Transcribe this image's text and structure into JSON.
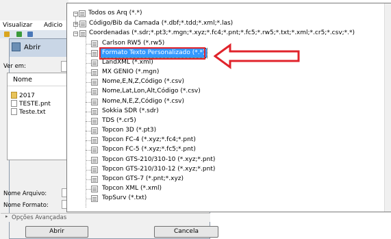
{
  "background_app": {
    "menu": [
      "Visualizar",
      "Adicio"
    ]
  },
  "dialog": {
    "title": "Abrir",
    "look_in_label": "Ver em:",
    "column_name": "Nome",
    "files": [
      {
        "name": "2017",
        "type": "folder"
      },
      {
        "name": "TESTE.pnt",
        "type": "file"
      },
      {
        "name": "Teste.txt",
        "type": "file"
      }
    ],
    "filename_label": "Nome Arquivo:",
    "format_label": "Nome Formato:",
    "advanced_options": "Opções Avançadas",
    "open_button": "Abrir",
    "cancel_button": "Cancela"
  },
  "dropdown": {
    "root": "Todos os Arq (*.*)",
    "groups": [
      {
        "label": "Código/Bib da Camada (*.dbf;*.tdd;*.xml;*.las)",
        "expander": "+"
      },
      {
        "label": "Coordenadas (*.sdr;*.pt3;*.mgn;*.xyz;*.fc4;*.pnt;*.fc5;*.rw5;*.txt;*.xml;*.cr5;*.csv;*.*)",
        "expander": "−"
      }
    ],
    "children": [
      "Carlson RW5 (*.rw5)",
      "Formato Texto Personalizado (*.*)",
      "LandXML (*.xml)",
      "MX GENIO (*.mgn)",
      "Nome,E,N,Z,Código (*.csv)",
      "Nome,Lat,Lon,Alt,Código (*.csv)",
      "Nome,N,E,Z,Código (*.csv)",
      "Sokkia SDR (*.sdr)",
      "TDS (*.cr5)",
      "Topcon 3D (*.pt3)",
      "Topcon FC-4 (*.xyz;*.fc4;*.pnt)",
      "Topcon FC-5 (*.xyz;*.fc5;*.pnt)",
      "Topcon GTS-210/310-10 (*.xyz;*.pnt)",
      "Topcon GTS-210/310-12 (*.xyz;*.pnt)",
      "Topcon GTS-7 (*.pnt;*.xyz)",
      "Topcon XML (*.xml)",
      "TopSurv (*.txt)"
    ],
    "selected_index": 1
  },
  "colors": {
    "selection": "#3399ff",
    "annotation": "#e0232b"
  },
  "icons": [
    "app-icon",
    "folder-icon",
    "file-icon",
    "file-type-icon",
    "expand-icon",
    "collapse-icon",
    "arrow-annotation-icon"
  ]
}
